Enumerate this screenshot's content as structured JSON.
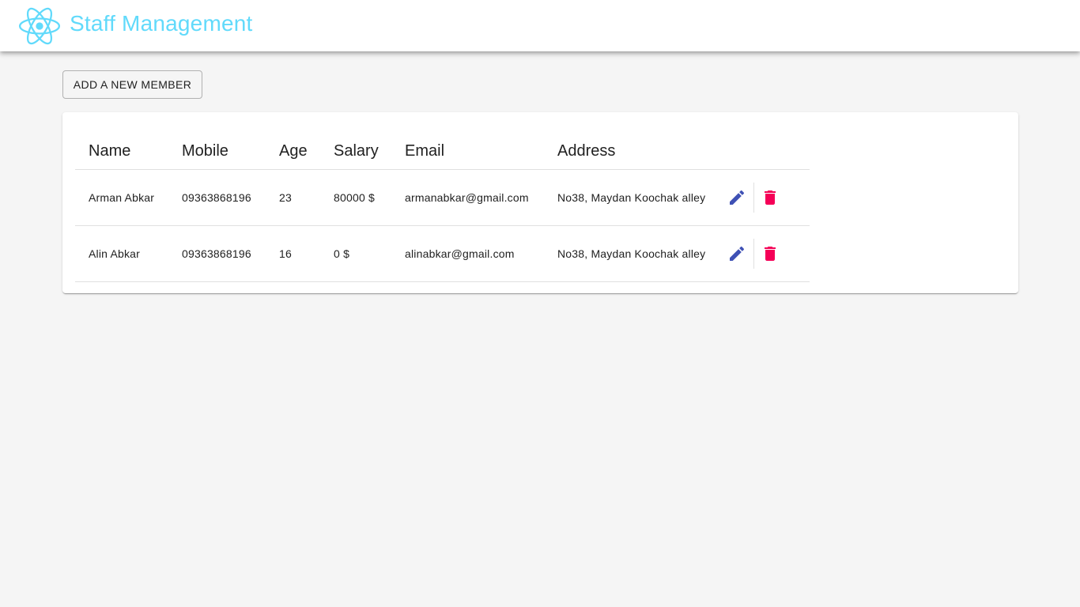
{
  "app": {
    "title": "Staff Management",
    "logo_icon": "react-atom-icon",
    "accent_color": "#61dafb"
  },
  "toolbar": {
    "add_label": "Add a new member"
  },
  "table": {
    "columns": [
      "Name",
      "Mobile",
      "Age",
      "Salary",
      "Email",
      "Address"
    ],
    "rows": [
      {
        "name": "Arman Abkar",
        "mobile": "09363868196",
        "age": "23",
        "salary": "80000 $",
        "email": "armanabkar@gmail.com",
        "address": "No38, Maydan Koochak alley"
      },
      {
        "name": "Alin Abkar",
        "mobile": "09363868196",
        "age": "16",
        "salary": "0 $",
        "email": "alinabkar@gmail.com",
        "address": "No38, Maydan Koochak alley"
      }
    ],
    "edit_icon": "pencil-icon",
    "delete_icon": "trash-icon",
    "edit_color": "#3f51b5",
    "delete_color": "#f50057"
  }
}
